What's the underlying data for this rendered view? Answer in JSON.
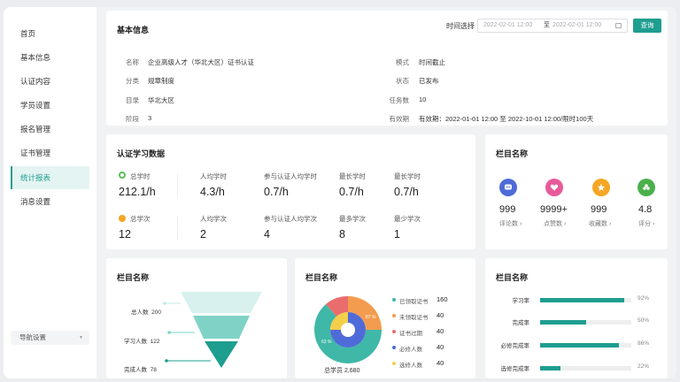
{
  "sidebar": {
    "items": [
      {
        "label": "首页"
      },
      {
        "label": "基本信息"
      },
      {
        "label": "认证内容"
      },
      {
        "label": "学员设置"
      },
      {
        "label": "报名管理"
      },
      {
        "label": "证书管理"
      },
      {
        "label": "统计报表",
        "active": true
      },
      {
        "label": "消息设置"
      }
    ],
    "settings_label": "导航设置"
  },
  "info": {
    "title": "基本信息",
    "time_label": "时间选择",
    "date_start": "2022-02-01 12:00",
    "date_sep": "至",
    "date_end": "2022-02-01 12:00",
    "query_label": "查询",
    "left": [
      {
        "label": "名称",
        "value": "企业高级人才（华北大区）证书认证"
      },
      {
        "label": "分类",
        "value": "规章制度"
      },
      {
        "label": "目录",
        "value": "华北大区"
      },
      {
        "label": "阶段",
        "value": "3"
      }
    ],
    "right": [
      {
        "label": "模式",
        "value": "时间截止"
      },
      {
        "label": "状态",
        "value": "已发布"
      },
      {
        "label": "任务数",
        "value": "10"
      },
      {
        "label": "有效期",
        "value": "有效期：2022-01-01 12:00 至 2022-10-01 12:00/限时100天"
      }
    ]
  },
  "stats": {
    "title": "认证学习数据",
    "row1": [
      {
        "label": "总学时",
        "value": "212.1/h"
      },
      {
        "label": "人均学时",
        "value": "4.3/h"
      },
      {
        "label": "参与认证人均学时",
        "value": "0.7/h"
      },
      {
        "label": "最长学时",
        "value": "0.7/h"
      },
      {
        "label": "最长学时",
        "value": "0.7/h"
      }
    ],
    "row2": [
      {
        "label": "总学次",
        "value": "12"
      },
      {
        "label": "人均学次",
        "value": "2"
      },
      {
        "label": "参与认证人均学次",
        "value": "4"
      },
      {
        "label": "最多学次",
        "value": "8"
      },
      {
        "label": "最少学次",
        "value": "1"
      }
    ],
    "icon_colors": {
      "row1": "#5bbf5b",
      "row2": "#f5a623"
    }
  },
  "columns": {
    "title": "栏目名称",
    "items": [
      {
        "value": "999",
        "label": "评论数 ›",
        "color": "#4f6bd8",
        "icon": "chat-icon"
      },
      {
        "value": "9999+",
        "label": "点赞数 ›",
        "color": "#e95a9a",
        "icon": "heart-icon"
      },
      {
        "value": "999",
        "label": "收藏数 ›",
        "color": "#f5a623",
        "icon": "star-icon"
      },
      {
        "value": "4.8",
        "label": "评分 ›",
        "color": "#4bb04b",
        "icon": "clover-icon"
      }
    ]
  },
  "funnel": {
    "title": "栏目名称",
    "stages": [
      {
        "label": "总人数",
        "value": "200"
      },
      {
        "label": "学习人数",
        "value": "122"
      },
      {
        "label": "完成人数",
        "value": "78"
      }
    ]
  },
  "donut": {
    "title": "栏目名称",
    "total_label": "总学员 2,680",
    "center_outer_label": "87 %",
    "center_inner_label": "63 %",
    "legend": [
      {
        "label": "已领取证书",
        "value": "160",
        "color": "#3fb8a8"
      },
      {
        "label": "未领取证书",
        "value": "40",
        "color": "#f39c4f"
      },
      {
        "label": "证书过期",
        "value": "40",
        "color": "#ea6d6d"
      },
      {
        "label": "必修人数",
        "value": "40",
        "color": "#4f6bd8"
      },
      {
        "label": "选修人数",
        "value": "40",
        "color": "#f3cf4a"
      }
    ]
  },
  "bars": {
    "title": "栏目名称",
    "items": [
      {
        "label": "学习率",
        "pct": "92%",
        "fraction": 0.92
      },
      {
        "label": "完成率",
        "pct": "50%",
        "fraction": 0.5
      },
      {
        "label": "必修完成率",
        "pct": "86%",
        "fraction": 0.86
      },
      {
        "label": "选修完成率",
        "pct": "22%",
        "fraction": 0.22
      }
    ]
  }
}
